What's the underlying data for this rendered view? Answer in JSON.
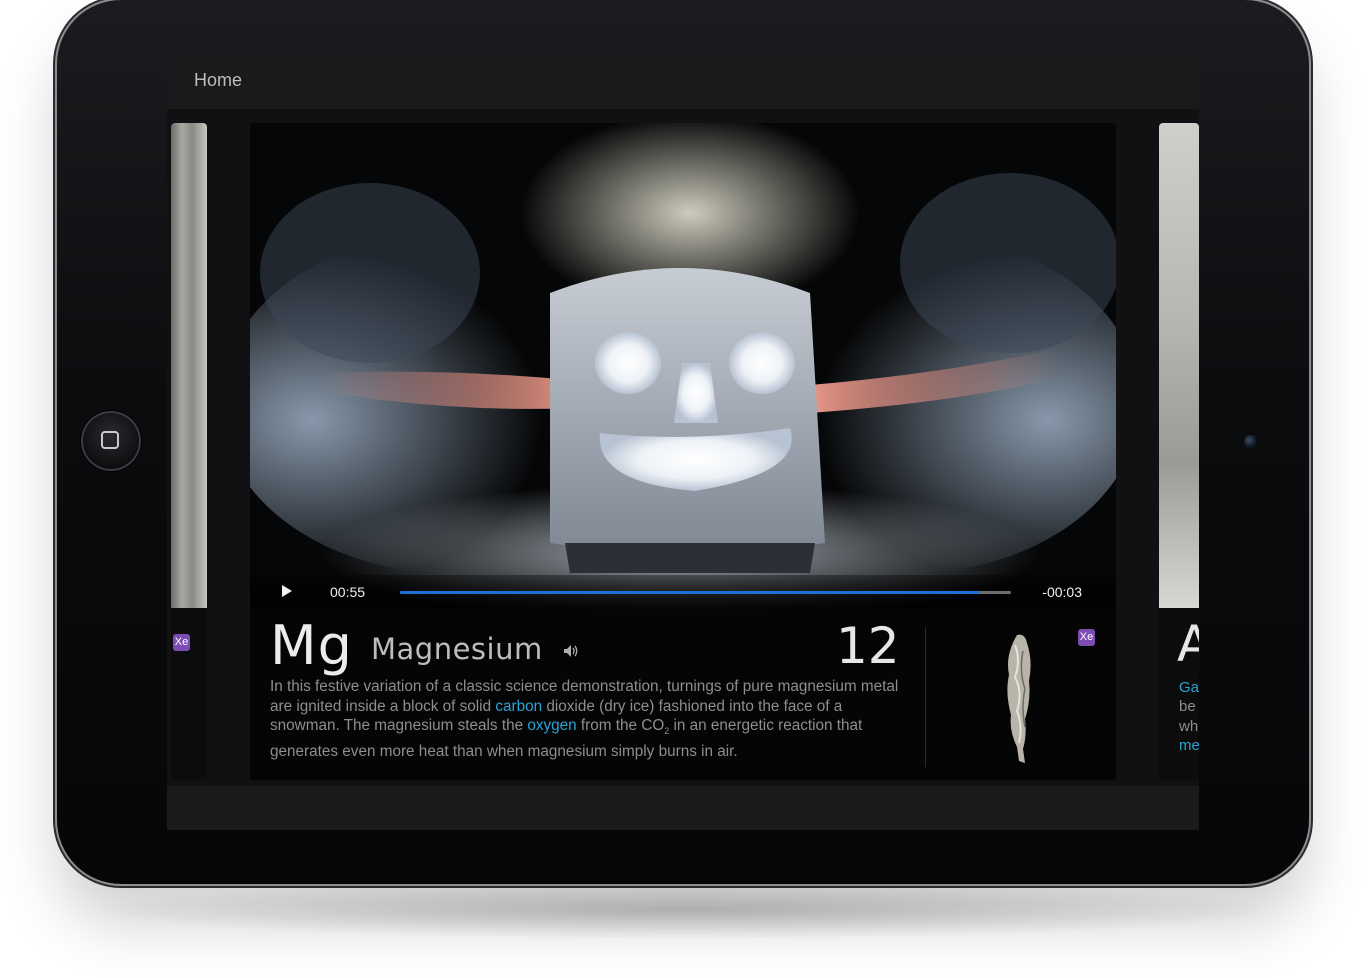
{
  "nav": {
    "home_label": "Home"
  },
  "left_card": {
    "badge": "Xe"
  },
  "right_card": {
    "letter": "A",
    "fragments": [
      "Ga",
      "be",
      "wh",
      "me"
    ]
  },
  "video": {
    "current_time": "00:55",
    "remaining_time": "-00:03",
    "progress": 0.95
  },
  "element": {
    "symbol": "Mg",
    "name": "Magnesium",
    "atomic_number": "12",
    "badge": "Xe",
    "description": {
      "p1": "In this festive variation of a classic science demonstration, turnings of pure magnesium metal are ignited inside a block of solid ",
      "link1": "carbon",
      "p2": " dioxide (dry ice) fashioned into the face of a snowman. The magnesium steals the ",
      "link2": "oxygen",
      "p3": " from the CO",
      "sub": "2",
      "p4": " in an energetic reaction that generates even more heat than when magnesium simply burns in air."
    }
  },
  "colors": {
    "accent_link": "#29a3d6",
    "progress_fill": "#1e6fd6",
    "badge": "#7c4bb3"
  },
  "icons": [
    "home-button-icon",
    "play-icon",
    "speaker-icon"
  ]
}
